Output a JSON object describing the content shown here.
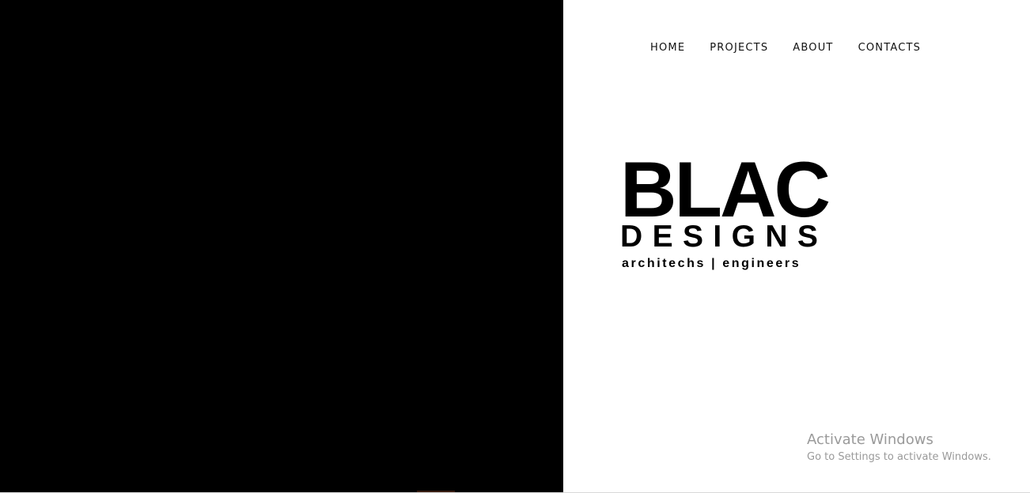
{
  "nav": {
    "items": [
      {
        "label": "HOME"
      },
      {
        "label": "PROJECTS"
      },
      {
        "label": "ABOUT"
      },
      {
        "label": "CONTACTS"
      }
    ]
  },
  "logo": {
    "main": "BLAC",
    "sub": "DESIGNS",
    "tagline": "architechs | engineers"
  },
  "watermark": {
    "title": "Activate Windows",
    "subtitle": "Go to Settings to activate Windows."
  },
  "colors": {
    "left_panel": "#000000",
    "right_panel": "#ffffff",
    "text": "#111111",
    "watermark": "#9a9a9a"
  }
}
